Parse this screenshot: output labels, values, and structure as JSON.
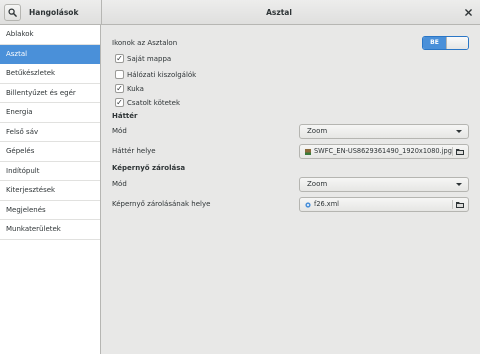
{
  "titlebar": {
    "sidebar_title": "Hangolások",
    "main_title": "Asztal"
  },
  "sidebar": {
    "items": [
      {
        "label": "Ablakok"
      },
      {
        "label": "Asztal"
      },
      {
        "label": "Betűkészletek"
      },
      {
        "label": "Billentyűzet és egér"
      },
      {
        "label": "Energia"
      },
      {
        "label": "Felső sáv"
      },
      {
        "label": "Gépelés"
      },
      {
        "label": "Indítópult"
      },
      {
        "label": "Kiterjesztések"
      },
      {
        "label": "Megjelenés"
      },
      {
        "label": "Munkaterületek"
      }
    ],
    "selected_index": 1
  },
  "desktop_icons": {
    "label": "Ikonok az Asztalon",
    "switch_label": "BE",
    "switch_on": true,
    "checkboxes": [
      {
        "label": "Saját mappa",
        "checked": true
      },
      {
        "label": "Hálózati kiszolgálók",
        "checked": false
      },
      {
        "label": "Kuka",
        "checked": true
      },
      {
        "label": "Csatolt kötetek",
        "checked": true
      }
    ]
  },
  "background": {
    "heading": "Háttér",
    "mode_label": "Mód",
    "mode_value": "Zoom",
    "location_label": "Háttér helye",
    "location_value": "SWFC_EN-US8629361490_1920x1080.jpg"
  },
  "lockscreen": {
    "heading": "Képernyő zárolása",
    "mode_label": "Mód",
    "mode_value": "Zoom",
    "location_label": "Képernyő zárolásának helye",
    "location_value": "f26.xml"
  },
  "colors": {
    "accent": "#4a90d9",
    "background": "#e8e8e7",
    "sidebar_bg": "#ffffff",
    "text": "#2e3436"
  },
  "icons": {
    "search": "search-icon",
    "close": "close-icon",
    "dropdown": "chevron-down-icon",
    "image_file": "image-file-icon",
    "xml_file": "xml-file-icon",
    "folder": "folder-icon"
  }
}
